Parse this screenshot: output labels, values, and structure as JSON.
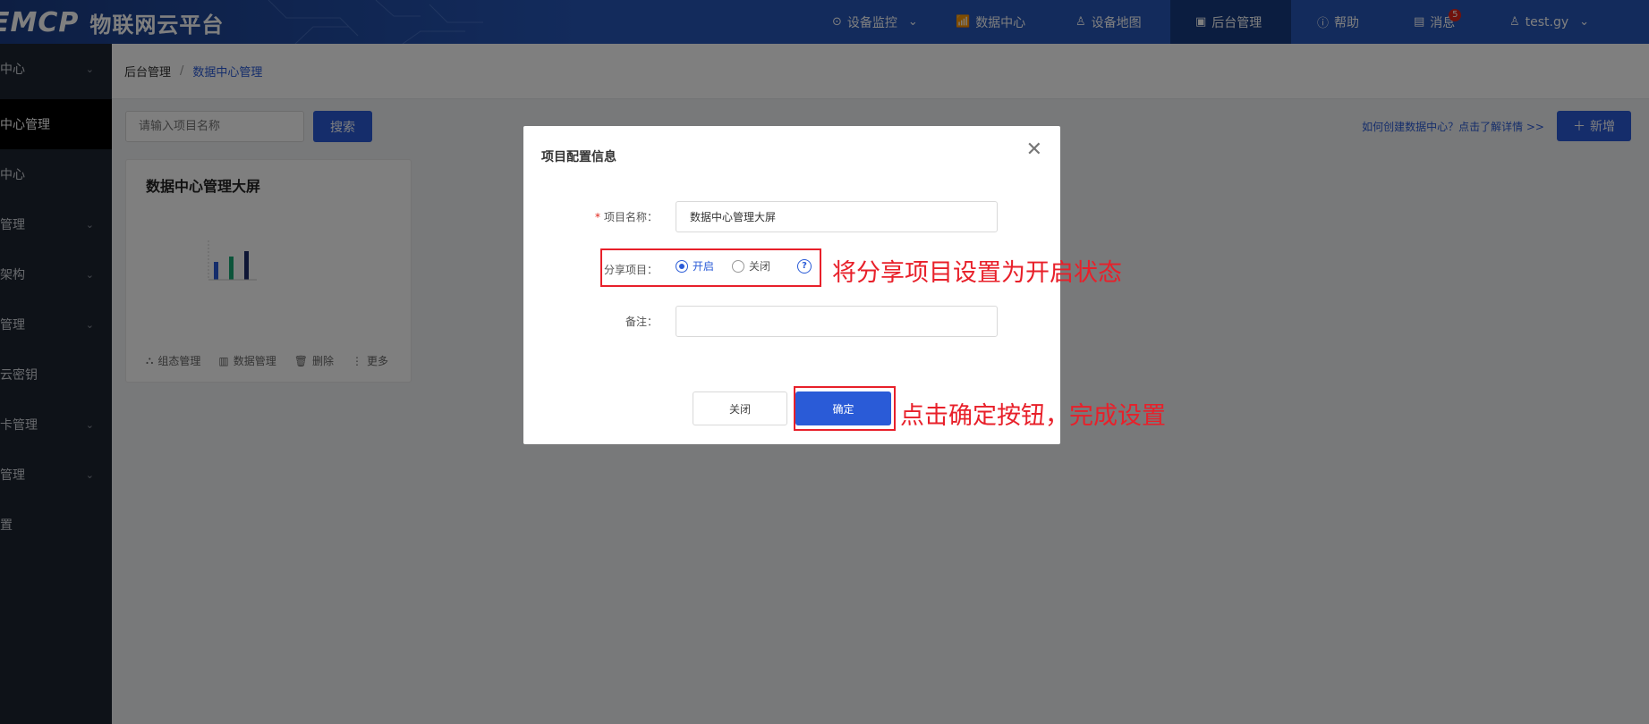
{
  "header": {
    "logo_mark": "EMCP",
    "logo_text": "物联网云平台",
    "nav": [
      {
        "label": "设备监控",
        "icon": "location-pin-icon"
      },
      {
        "label": "数据中心",
        "icon": "chart-icon"
      },
      {
        "label": "设备地图",
        "icon": "map-user-icon"
      },
      {
        "label": "后台管理",
        "icon": "monitor-icon"
      },
      {
        "label": "帮助",
        "icon": "question-icon"
      },
      {
        "label": "消息",
        "icon": "message-icon",
        "badge": "5"
      },
      {
        "label": "test.gy",
        "icon": "user-icon"
      }
    ]
  },
  "sidebar": {
    "items": [
      {
        "label": "中心"
      },
      {
        "label": "中心管理"
      },
      {
        "label": "中心"
      },
      {
        "label": "管理"
      },
      {
        "label": "架构"
      },
      {
        "label": "管理"
      },
      {
        "label": "云密钥"
      },
      {
        "label": "卡管理"
      },
      {
        "label": "管理"
      },
      {
        "label": "置"
      }
    ]
  },
  "breadcrumb": {
    "root": "后台管理",
    "sep": "/",
    "current": "数据中心管理"
  },
  "toolbar": {
    "search_placeholder": "请输入项目名称",
    "search_label": "搜索",
    "help_link": "如何创建数据中心？点击了解详情 >>",
    "add_label": "新增"
  },
  "card": {
    "title": "数据中心管理大屏",
    "actions": [
      "组态管理",
      "数据管理",
      "删除",
      "更多"
    ]
  },
  "modal": {
    "title": "项目配置信息",
    "name_label": "项目名称：",
    "name_value": "数据中心管理大屏",
    "share_label": "分享项目：",
    "share_on": "开启",
    "share_off": "关闭",
    "share_selected": "开启",
    "remark_label": "备注：",
    "remark_value": "",
    "cancel_label": "关闭",
    "ok_label": "确定"
  },
  "annotations": {
    "note1": "将分享项目设置为开启状态",
    "note2": "点击确定按钮，完成设置",
    "color": "#e8202a"
  },
  "colors": {
    "primary": "#2a5bd7",
    "header": "#2656b8",
    "sidebar": "#1d2431"
  }
}
